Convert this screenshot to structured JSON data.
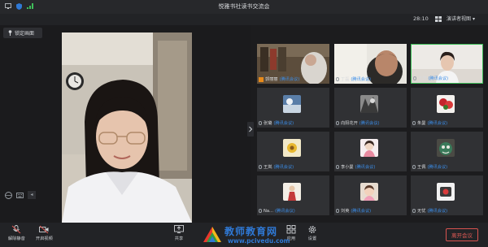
{
  "titlebar": {
    "title": "悦雅书社读书交流会"
  },
  "topbar": {
    "timer": "28:10",
    "view_label": "演讲者视图"
  },
  "lock_button": {
    "label": "锁定画面"
  },
  "tiles": [
    {
      "name": "郭丽丽",
      "via": "(腾讯会议)"
    },
    {
      "name": "丁磊",
      "via": "(腾讯会议)"
    },
    {
      "name": "王芳",
      "via": "(腾讯会议)"
    },
    {
      "name": "张璐",
      "via": "(腾讯会议)"
    },
    {
      "name": "向阳花开",
      "via": "(腾讯会议)"
    },
    {
      "name": "朱曼",
      "via": "(腾讯会议)"
    },
    {
      "name": "王岚",
      "via": "(腾讯会议)"
    },
    {
      "name": "李小曼",
      "via": "(腾讯会议)"
    },
    {
      "name": "王佩",
      "via": "(腾讯会议)"
    },
    {
      "name": "Na...",
      "via": "(腾讯会议)"
    },
    {
      "name": "刘英",
      "via": "(腾讯会议)"
    },
    {
      "name": "无忧",
      "via": "(腾讯会议)"
    }
  ],
  "toolbar": {
    "unmute": "解除静音",
    "start_video": "开启视频",
    "share": "共享",
    "apps": "应用",
    "settings": "设置",
    "leave": "离开会议"
  },
  "watermark": {
    "line1": "教师教育网",
    "line2": "www.pcivedu.com"
  },
  "colors": {
    "accent": "#3b8eea",
    "leave": "#e05a55",
    "background": "#1c1c1e"
  }
}
